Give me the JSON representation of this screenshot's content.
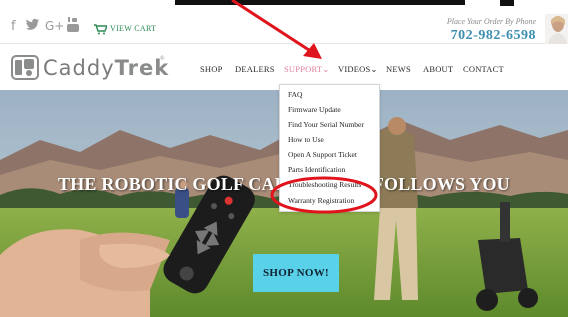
{
  "social": {
    "icons": [
      "facebook-icon",
      "twitter-icon",
      "google-plus-icon",
      "youtube-icon"
    ],
    "facebook_glyph": "f",
    "twitter_glyph": "𝕪",
    "googleplus_glyph": "G+",
    "youtube_glyph": "You",
    "view_cart": "VIEW CART"
  },
  "contact": {
    "prompt": "Place Your Order By Phone",
    "phone": "702-982-6598"
  },
  "brand": {
    "logo_caddy": "Caddy",
    "logo_trek": "Trek",
    "registered": "®"
  },
  "nav": {
    "shop": "SHOP",
    "dealers": "DEALERS",
    "support": "SUPPORT",
    "videos": "VIDEOS",
    "news": "NEWS",
    "about": "ABOUT",
    "contact": "CONTACT",
    "caret": "⌄"
  },
  "support_menu": {
    "items": [
      "FAQ",
      "Firmware Update",
      "Find Your Serial Number",
      "How to Use",
      "Open A Support Ticket",
      "Parts Identification",
      "Troubleshooting Results",
      "Warranty Registration"
    ]
  },
  "hero": {
    "title": "THE ROBOTIC GOLF CADDY THAT FOLLOWS YOU",
    "cta": "SHOP NOW!"
  },
  "colors": {
    "accent_cyan": "#59d1e8",
    "support_pink": "#e07f9b",
    "phone_blue": "#3d8fb0",
    "annotation_red": "#e0141c",
    "cart_green": "#2c8a54"
  }
}
